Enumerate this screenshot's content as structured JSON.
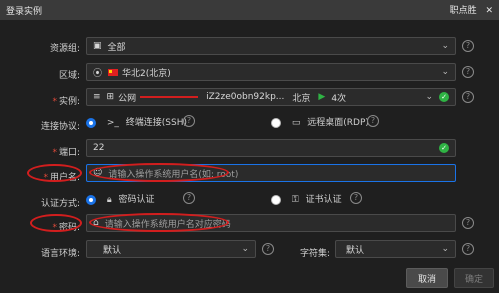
{
  "window": {
    "title": "登录实例",
    "brand": "职点胜",
    "close": "✕"
  },
  "form": {
    "resource_group": {
      "label": "资源组:",
      "value": "全部"
    },
    "region": {
      "label": "区域:",
      "value": "华北2(北京)"
    },
    "instance": {
      "label": "实例:",
      "name": "公网",
      "id": "iZ2ze0obn92kp...",
      "location": "北京",
      "count": "4次"
    },
    "protocol": {
      "label": "连接协议:",
      "opt1": "终端连接(SSH)",
      "opt2": "远程桌面(RDP)"
    },
    "port": {
      "label": "端口:",
      "value": "22"
    },
    "username": {
      "label": "用户名:",
      "placeholder": "请输入操作系统用户名(如: root)"
    },
    "auth": {
      "label": "认证方式:",
      "opt1": "密码认证",
      "opt2": "证书认证"
    },
    "password": {
      "label": "密码:",
      "placeholder": "请输入操作系统用户名对应密码"
    },
    "language": {
      "label": "语言环境:",
      "value": "默认"
    },
    "charset": {
      "label": "字符集:",
      "value": "默认"
    }
  },
  "buttons": {
    "cancel": "取消",
    "confirm": "确定"
  },
  "icons": {
    "chevron": "⌄",
    "help": "?",
    "check": "✓"
  },
  "colors": {
    "accent": "#1a73e8",
    "ok": "#2fb344",
    "annotation": "#d21e1e"
  }
}
